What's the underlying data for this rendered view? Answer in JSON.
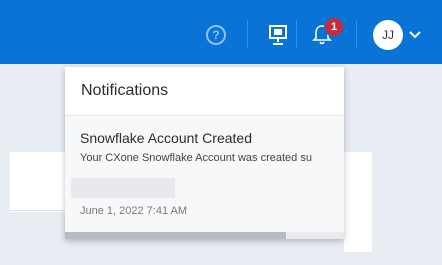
{
  "topbar": {
    "help_icon": "question-circle-icon",
    "help_glyph": "?",
    "presenter_icon": "presentation-icon",
    "bell_icon": "bell-icon",
    "notification_count": "1",
    "user_initials": "JJ",
    "user_menu_icon": "chevron-down-icon",
    "accent_color": "#0a73d6",
    "badge_color": "#c62c3c"
  },
  "notifications": {
    "title": "Notifications",
    "items": [
      {
        "title": "Snowflake Account Created",
        "body": "Your CXone Snowflake Account was created su",
        "date": "June 1, 2022 7:41 AM"
      }
    ],
    "scroll_position": 0.79
  }
}
